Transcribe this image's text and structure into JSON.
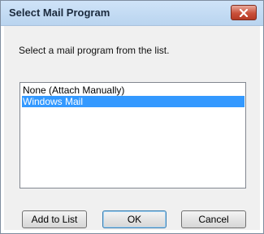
{
  "window": {
    "title": "Select Mail Program"
  },
  "instruction": "Select a mail program from the list.",
  "mail_programs": [
    {
      "label": "None (Attach Manually)",
      "selected": false
    },
    {
      "label": "Windows Mail",
      "selected": true
    }
  ],
  "buttons": {
    "add_to_list": "Add to List",
    "ok": "OK",
    "cancel": "Cancel"
  },
  "icons": {
    "close": "close-icon"
  },
  "colors": {
    "selection": "#3399ff",
    "close_button": "#c9503a",
    "titlebar": "#c4dbf3"
  }
}
